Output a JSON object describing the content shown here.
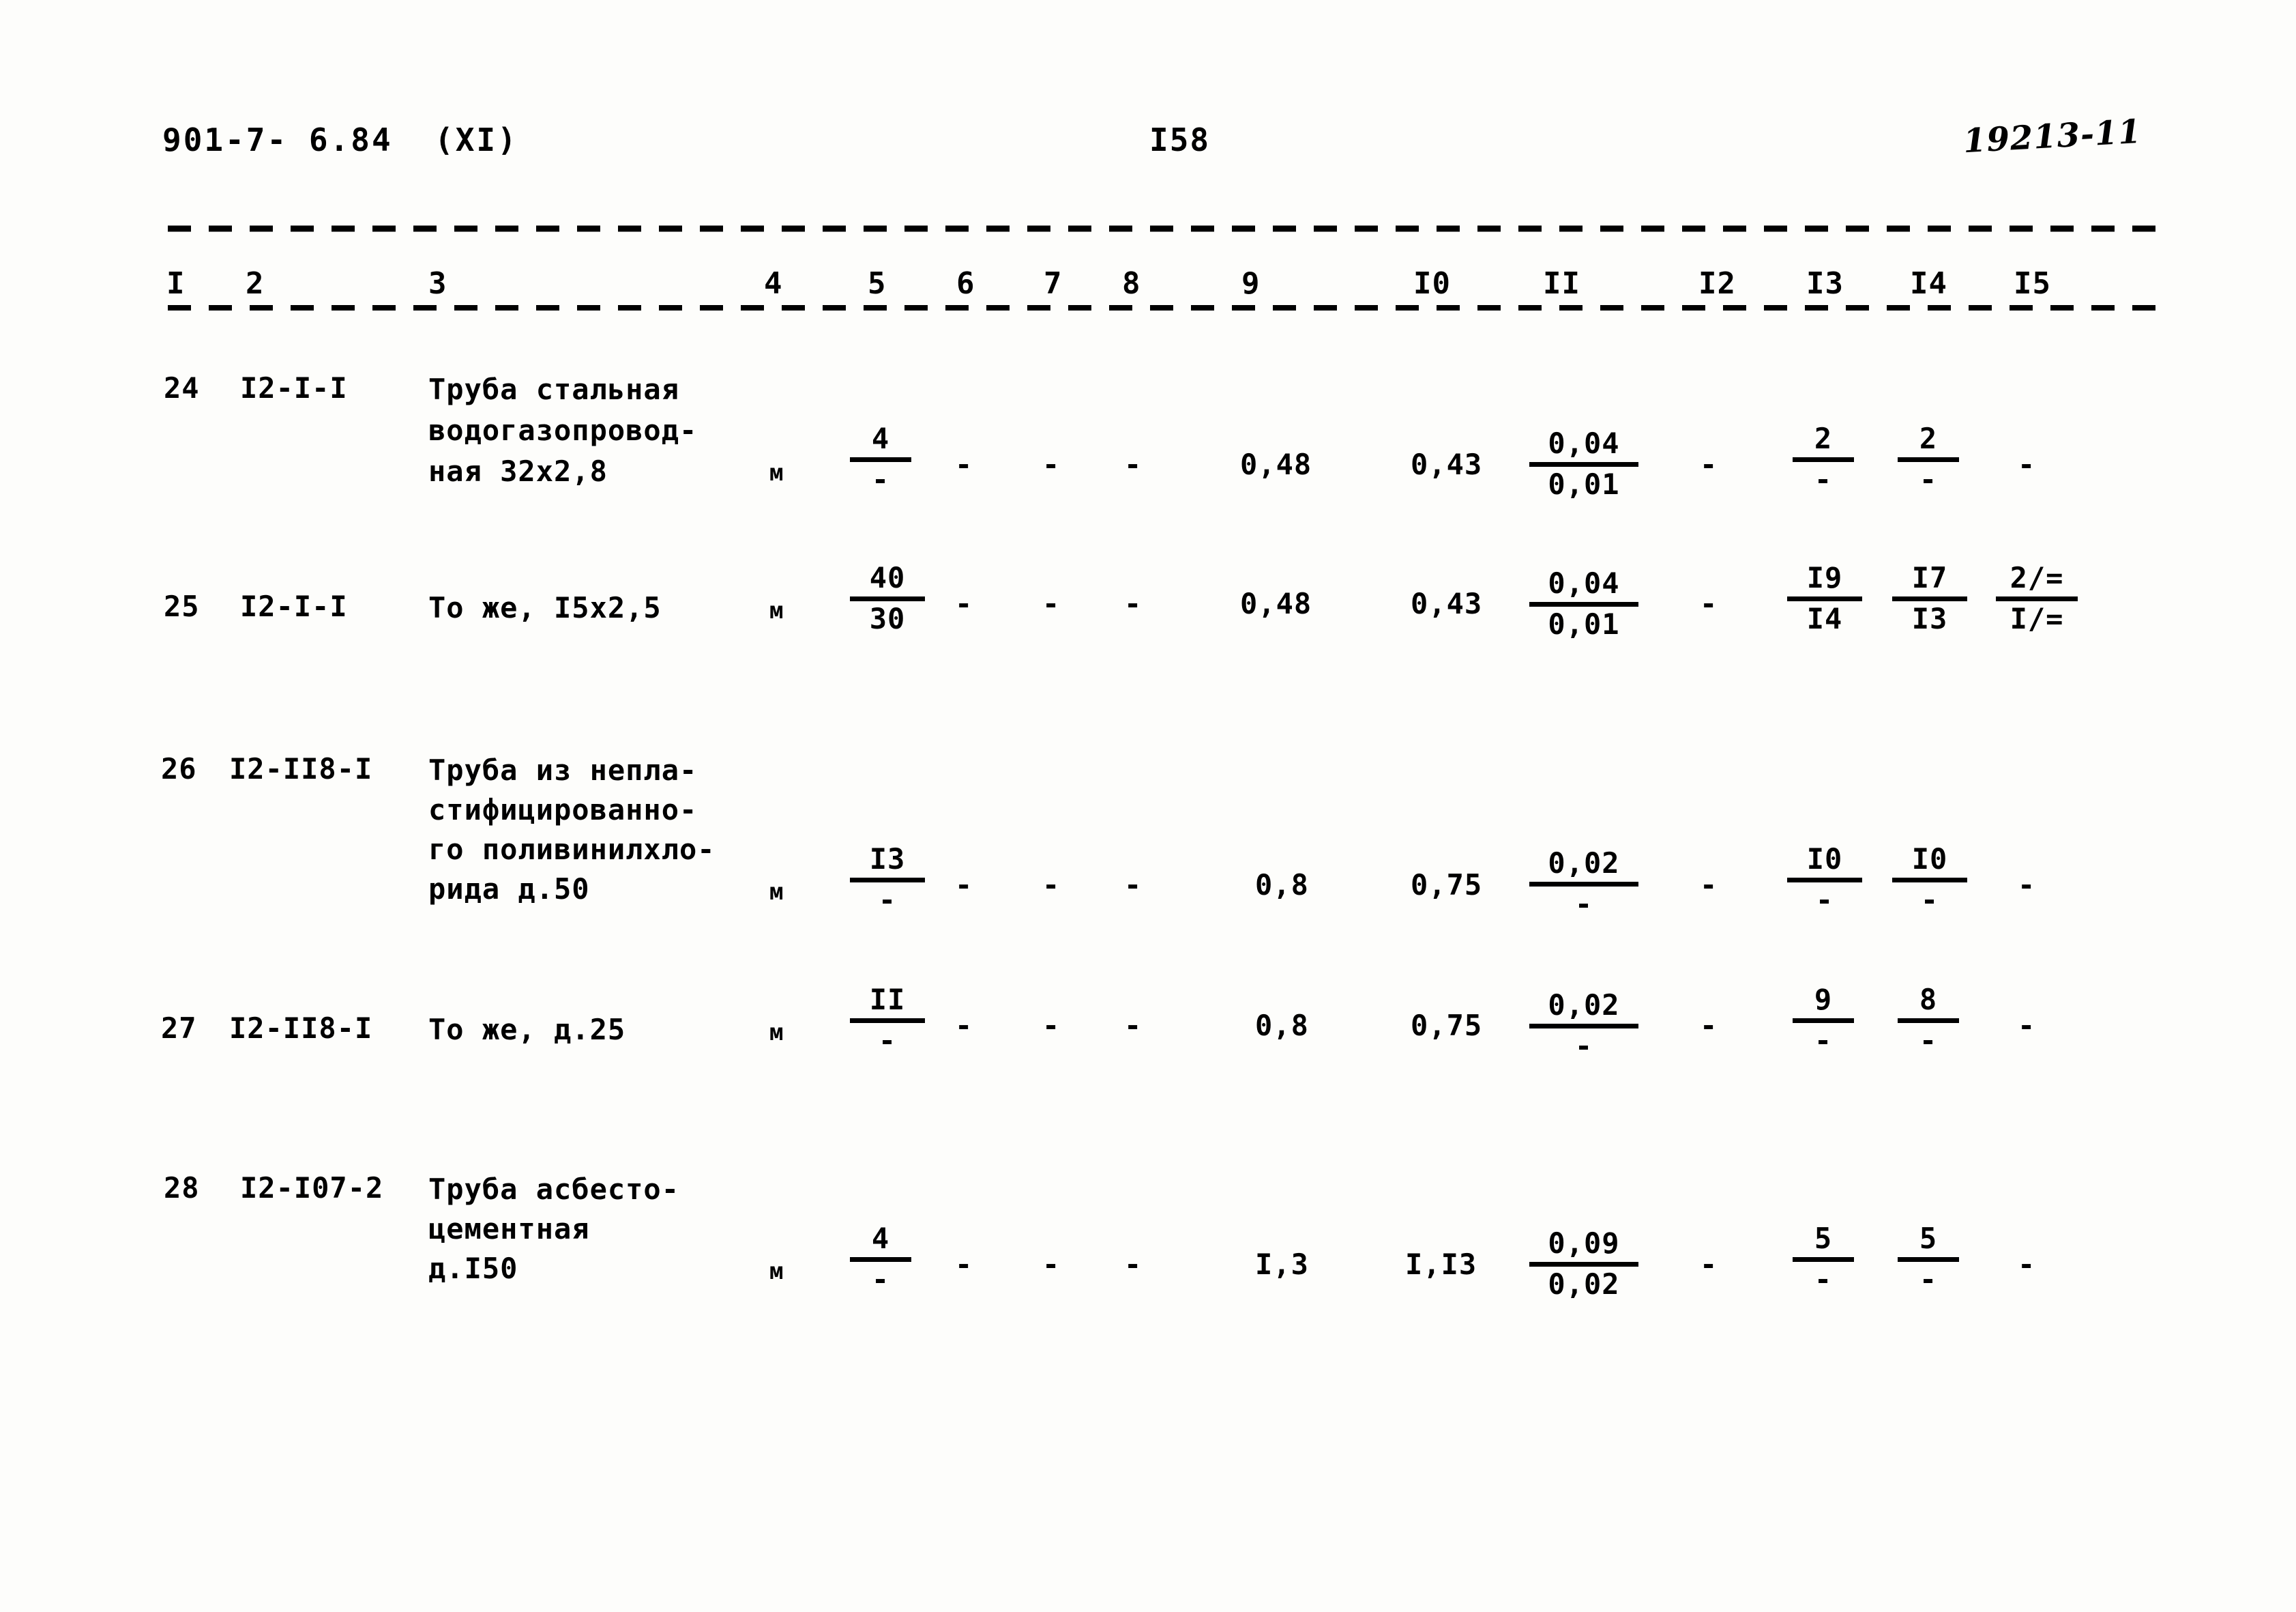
{
  "header": {
    "document_code": "901-7- 6.84  (XI)",
    "page_number": "I58",
    "handwritten_mark": "19213-11"
  },
  "table": {
    "column_numbers": [
      "I",
      "2",
      "3",
      "4",
      "5",
      "6",
      "7",
      "8",
      "9",
      "I0",
      "II",
      "I2",
      "I3",
      "I4",
      "I5"
    ],
    "rows": [
      {
        "num": "24",
        "code": "I2-I-I",
        "desc_lines": [
          "Труба стальная",
          "водогазопровод-",
          "ная 32х2,8"
        ],
        "unit": "м",
        "c5_num": "4",
        "c5_den": "-",
        "c6": "-",
        "c7": "-",
        "c8": "-",
        "c9": "0,48",
        "c10": "0,43",
        "c11_num": "0,04",
        "c11_den": "0,01",
        "c12": "-",
        "c13_num": "2",
        "c13_den": "-",
        "c14_num": "2",
        "c14_den": "-",
        "c15": "-"
      },
      {
        "num": "25",
        "code": "I2-I-I",
        "desc_lines": [
          "То же, I5х2,5"
        ],
        "unit": "м",
        "c5_num": "40",
        "c5_den": "30",
        "c6": "-",
        "c7": "-",
        "c8": "-",
        "c9": "0,48",
        "c10": "0,43",
        "c11_num": "0,04",
        "c11_den": "0,01",
        "c12": "-",
        "c13_num": "I9",
        "c13_den": "I4",
        "c14_num": "I7",
        "c14_den": "I3",
        "c15_num": "2/=",
        "c15_den": "I/="
      },
      {
        "num": "26",
        "code": "I2-II8-I",
        "desc_lines": [
          "Труба из непла-",
          "стифицированно-",
          "го поливинилхло-",
          "рида д.50"
        ],
        "unit": "м",
        "c5_num": "I3",
        "c5_den": "-",
        "c6": "-",
        "c7": "-",
        "c8": "-",
        "c9": "0,8",
        "c10": "0,75",
        "c11_num": "0,02",
        "c11_den": "-",
        "c12": "-",
        "c13_num": "I0",
        "c13_den": "-",
        "c14_num": "I0",
        "c14_den": "-",
        "c15": "-"
      },
      {
        "num": "27",
        "code": "I2-II8-I",
        "desc_lines": [
          "То же, д.25"
        ],
        "unit": "м",
        "c5_num": "II",
        "c5_den": "-",
        "c6": "-",
        "c7": "-",
        "c8": "-",
        "c9": "0,8",
        "c10": "0,75",
        "c11_num": "0,02",
        "c11_den": "-",
        "c12": "-",
        "c13_num": "9",
        "c13_den": "-",
        "c14_num": "8",
        "c14_den": "-",
        "c15": "-"
      },
      {
        "num": "28",
        "code": "I2-I07-2",
        "desc_lines": [
          "Труба асбесто-",
          "цементная",
          "д.I50"
        ],
        "unit": "м",
        "c5_num": "4",
        "c5_den": "-",
        "c6": "-",
        "c7": "-",
        "c8": "-",
        "c9": "I,3",
        "c10": "I,I3",
        "c11_num": "0,09",
        "c11_den": "0,02",
        "c12": "-",
        "c13_num": "5",
        "c13_den": "-",
        "c14_num": "5",
        "c14_den": "-",
        "c15": "-"
      }
    ]
  }
}
